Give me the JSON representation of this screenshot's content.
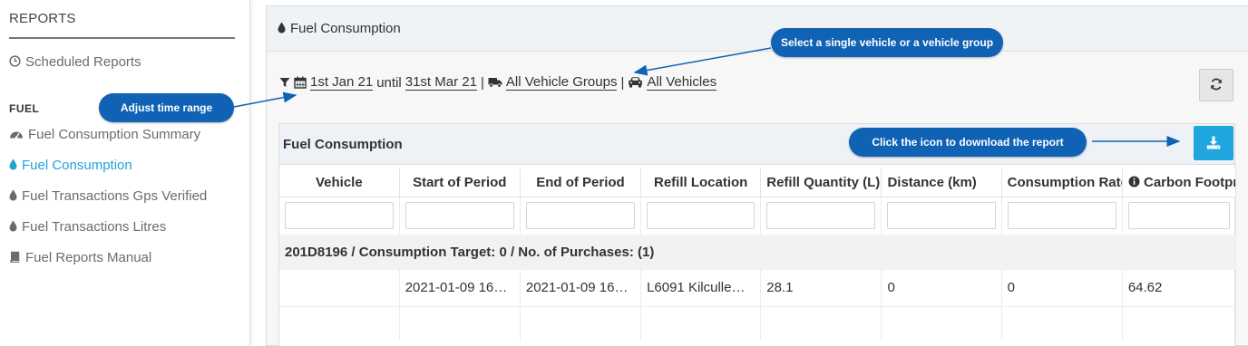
{
  "sidebar": {
    "title": "REPORTS",
    "scheduled": "Scheduled Reports",
    "section": "FUEL",
    "items": [
      {
        "label": "Fuel Consumption Summary",
        "icon": "dashboard-icon"
      },
      {
        "label": "Fuel Consumption",
        "icon": "droplet-icon",
        "active": true
      },
      {
        "label": "Fuel Transactions Gps Verified",
        "icon": "droplet-icon"
      },
      {
        "label": "Fuel Transactions Litres",
        "icon": "droplet-icon"
      },
      {
        "label": "Fuel Reports Manual",
        "icon": "book-icon"
      }
    ]
  },
  "panel": {
    "title": "Fuel Consumption"
  },
  "filters": {
    "start": "1st Jan 21",
    "until": "until",
    "end": "31st Mar 21",
    "sep": "|",
    "groups": "All Vehicle Groups",
    "vehicles": "All Vehicles"
  },
  "card": {
    "title": "Fuel Consumption"
  },
  "table": {
    "columns": [
      "Vehicle",
      "Start of Period",
      "End of Period",
      "Refill Location",
      "Refill Quantity (L)",
      "Distance (km)",
      "Consumption Rate",
      "Carbon Footprint"
    ],
    "group": "201D8196 / Consumption Target: 0 / No. of Purchases: (1)",
    "rows": [
      [
        "",
        "2021-01-09 16…",
        "2021-01-09 16…",
        "L6091 Kilculle…",
        "28.1",
        "0",
        "0",
        "64.62"
      ]
    ]
  },
  "callouts": {
    "vehicle": "Select a single vehicle or a vehicle group",
    "time": "Adjust time range",
    "download": "Click the icon to download the report"
  },
  "colors": {
    "accent": "#1fa3d6",
    "callout": "#1062b5",
    "download_button": "#1fa6de"
  }
}
